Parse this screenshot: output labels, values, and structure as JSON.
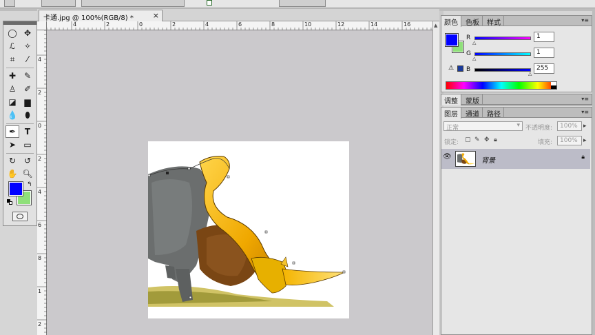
{
  "document": {
    "tab_title": "卡通.jpg @ 100%(RGB/8) *",
    "close_glyph": "×"
  },
  "rulers": {
    "horizontal": [
      "4",
      "2",
      "0",
      "2",
      "4",
      "6",
      "8",
      "10",
      "12",
      "14",
      "16"
    ],
    "vertical": [
      "4",
      "2",
      "0",
      "2",
      "4",
      "6",
      "8",
      "1",
      "2"
    ]
  },
  "color_panel": {
    "tabs": [
      "颜色",
      "色板",
      "样式"
    ],
    "channels": [
      {
        "label": "R",
        "value": "1"
      },
      {
        "label": "G",
        "value": "1"
      },
      {
        "label": "B",
        "value": "255"
      }
    ],
    "foreground": "#0000ff",
    "background": "#8fe07a",
    "web_safe": "#1a3a9a"
  },
  "adjust_panel": {
    "tabs": [
      "调整",
      "蒙版"
    ]
  },
  "layers_panel": {
    "tabs": [
      "图层",
      "通道",
      "路径"
    ],
    "blend_mode": "正常",
    "opacity_label": "不透明度:",
    "opacity_value": "100%",
    "lock_label": "锁定:",
    "fill_label": "填充:",
    "fill_value": "100%",
    "layers": [
      {
        "name": "背景",
        "visible": true,
        "locked": true
      }
    ]
  },
  "panel_menu_glyph": "▾≡",
  "icons": {
    "eye": "eye-icon",
    "lock": "lock-icon",
    "warning": "warning-icon"
  }
}
